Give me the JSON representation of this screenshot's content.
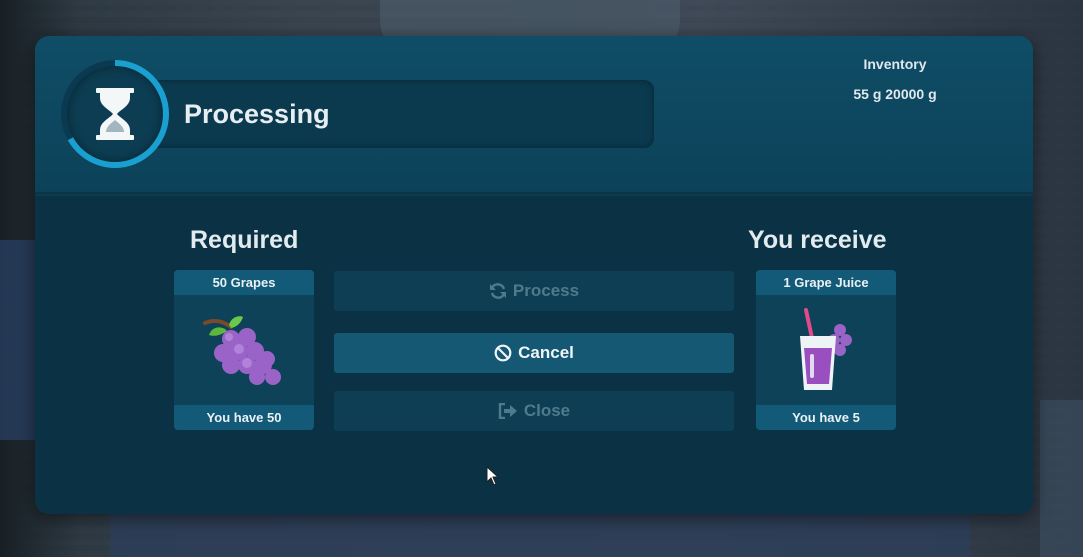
{
  "header": {
    "title": "Processing",
    "timer_progress": 0.67,
    "inventory_label": "Inventory",
    "inventory_value": "55 g 20000 g"
  },
  "required": {
    "heading": "Required",
    "item_name": "50 Grapes",
    "have_text": "You have 50",
    "icon": "grapes-icon"
  },
  "receive": {
    "heading": "You receive",
    "item_name": "1 Grape Juice",
    "have_text": "You have 5",
    "icon": "grape-juice-icon"
  },
  "actions": {
    "process_label": "Process",
    "cancel_label": "Cancel",
    "close_label": "Close"
  },
  "colors": {
    "accent": "#1aa0d0",
    "panel": "#0b3244",
    "button_active": "#145873"
  }
}
